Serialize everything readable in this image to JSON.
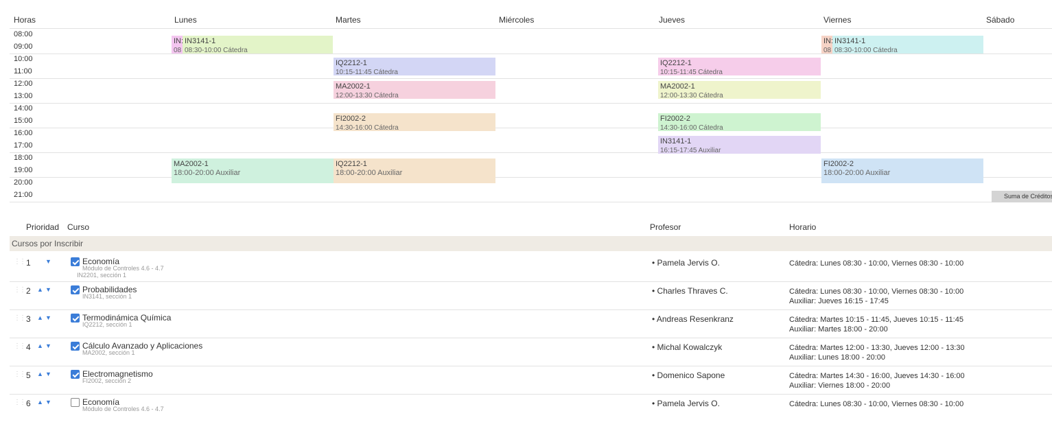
{
  "calendar": {
    "header_horas": "Horas",
    "days": [
      "Lunes",
      "Martes",
      "Miércoles",
      "Jueves",
      "Viernes",
      "Sábado"
    ],
    "hours": [
      "08:00",
      "09:00",
      "10:00",
      "11:00",
      "12:00",
      "13:00",
      "14:00",
      "15:00",
      "16:00",
      "17:00",
      "18:00",
      "19:00",
      "20:00",
      "21:00"
    ],
    "events": [
      {
        "code": "IN:",
        "time": "08",
        "color": "#f4c6f0"
      },
      {
        "code": "IN3141-1",
        "time": "08:30-10:00 Cátedra",
        "color": "#e3f4c8"
      },
      {
        "code": "IQ2212-1",
        "time": "10:15-11:45 Cátedra",
        "color": "#d3d6f5"
      },
      {
        "code": "MA2002-1",
        "time": "12:00-13:30 Cátedra",
        "color": "#f6d1de"
      },
      {
        "code": "FI2002-2",
        "time": "14:30-16:00 Cátedra",
        "color": "#f5e3cb"
      },
      {
        "code": "IQ2212-1",
        "time": "10:15-11:45 Cátedra",
        "color": "#f6cdea"
      },
      {
        "code": "MA2002-1",
        "time": "12:00-13:30 Cátedra",
        "color": "#eff4cc"
      },
      {
        "code": "FI2002-2",
        "time": "14:30-16:00 Cátedra",
        "color": "#cef3d0"
      },
      {
        "code": "IN3141-1",
        "time": "16:15-17:45 Auxiliar",
        "color": "#e2d6f5"
      },
      {
        "code": "MA2002-1",
        "time": "18:00-20:00 Auxiliar",
        "color": "#cff1de"
      },
      {
        "code": "IQ2212-1",
        "time": "18:00-20:00 Auxiliar",
        "color": "#f5e3cb"
      },
      {
        "code": "IN:",
        "time": "08",
        "color": "#f6d3c6"
      },
      {
        "code": "IN3141-1",
        "time": "08:30-10:00 Cátedra",
        "color": "#cdf1f1"
      },
      {
        "code": "FI2002-2",
        "time": "18:00-20:00 Auxiliar",
        "color": "#cfe3f5"
      }
    ],
    "sum_button": "Suma de Créditos"
  },
  "table": {
    "col_prioridad": "Prioridad",
    "col_curso": "Curso",
    "col_profesor": "Profesor",
    "col_horario": "Horario",
    "group_label": "Cursos por Inscribir",
    "rows": [
      {
        "num": "1",
        "name": "Economía",
        "sub": "Módulo de Controles 4.6 - 4.7",
        "sub2": "IN2201, sección 1",
        "prof": "Pamela Jervis O.",
        "sch1": "Cátedra: Lunes 08:30 - 10:00, Viernes 08:30 - 10:00",
        "sch2": "",
        "checked": true
      },
      {
        "num": "2",
        "name": "Probabilidades",
        "sub": "IN3141, sección 1",
        "sub2": "",
        "prof": "Charles Thraves C.",
        "sch1": "Cátedra: Lunes 08:30 - 10:00, Viernes 08:30 - 10:00",
        "sch2": "Auxiliar: Jueves 16:15 - 17:45",
        "checked": true
      },
      {
        "num": "3",
        "name": "Termodinámica Química",
        "sub": "IQ2212, sección 1",
        "sub2": "",
        "prof": "Andreas Resenkranz",
        "sch1": "Cátedra: Martes 10:15 - 11:45, Jueves 10:15 - 11:45",
        "sch2": "Auxiliar: Martes 18:00 - 20:00",
        "checked": true
      },
      {
        "num": "4",
        "name": "Cálculo Avanzado y Aplicaciones",
        "sub": "MA2002, sección 1",
        "sub2": "",
        "prof": "Michal Kowalczyk",
        "sch1": "Cátedra: Martes 12:00 - 13:30, Jueves 12:00 - 13:30",
        "sch2": "Auxiliar: Lunes 18:00 - 20:00",
        "checked": true
      },
      {
        "num": "5",
        "name": "Electromagnetismo",
        "sub": "FI2002, sección 2",
        "sub2": "",
        "prof": "Domenico Sapone",
        "sch1": "Cátedra: Martes 14:30 - 16:00, Jueves 14:30 - 16:00",
        "sch2": "Auxiliar: Viernes 18:00 - 20:00",
        "checked": true
      },
      {
        "num": "6",
        "name": "Economía",
        "sub": "Módulo de Controles 4.6 - 4.7",
        "sub2": "",
        "prof": "Pamela Jervis O.",
        "sch1": "Cátedra: Lunes 08:30 - 10:00, Viernes 08:30 - 10:00",
        "sch2": "",
        "checked": false
      }
    ]
  },
  "colors": {
    "accent": "#3b7dd8",
    "group_bg": "#efebe4"
  },
  "icons": {
    "up": "arrow-up-icon",
    "down": "arrow-down-icon",
    "check": "checkbox-icon",
    "grip": "drag-handle-icon"
  }
}
